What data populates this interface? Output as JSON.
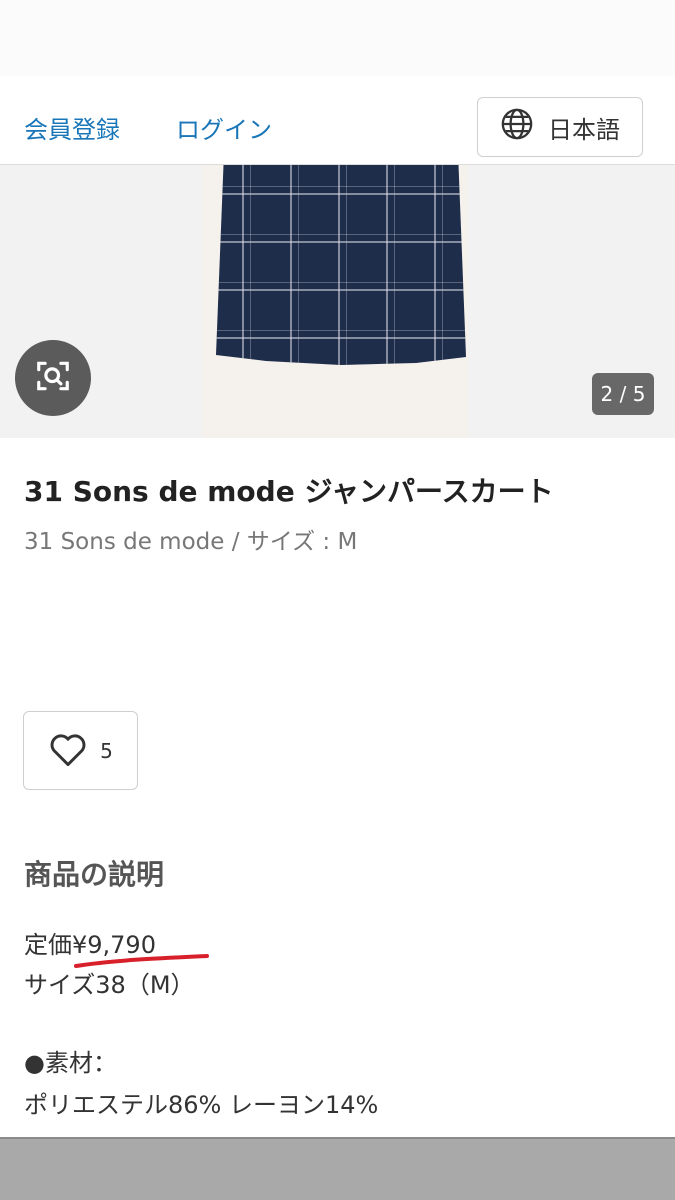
{
  "header": {
    "register_label": "会員登録",
    "login_label": "ログイン",
    "language_label": "日本語",
    "language_icon": "globe-icon"
  },
  "gallery": {
    "counter": "2 / 5",
    "image_search_icon": "image-search-icon"
  },
  "product": {
    "title": "31 Sons de mode ジャンパースカート",
    "subtitle": "31 Sons de mode / サイズ : M",
    "like_count": "5",
    "like_icon": "heart-icon"
  },
  "description": {
    "heading": "商品の説明",
    "lines": [
      "定価¥9,790",
      "サイズ38（M）",
      "●素材：",
      "ポリエステル86% レーヨン14%"
    ]
  },
  "colors": {
    "link": "#1976b8",
    "annotation_red": "#d8202a"
  }
}
